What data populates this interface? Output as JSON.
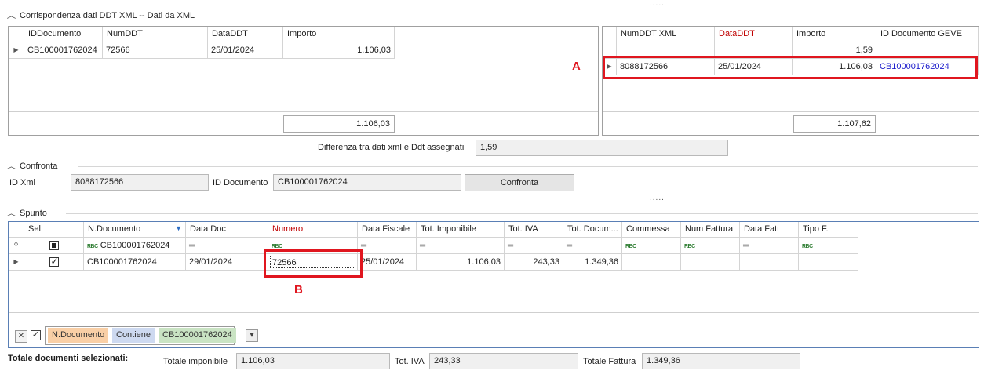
{
  "splitter_grip": ".....",
  "corrispondenza": {
    "title": "Corrispondenza dati DDT  XML --  Dati da XML",
    "ddt_grid": {
      "headers": [
        "IDDocumento",
        "NumDDT",
        "DataDDT",
        "Importo"
      ],
      "rows": [
        [
          "CB100001762024",
          "72566",
          "25/01/2024",
          "1.106,03"
        ]
      ],
      "total": "1.106,03"
    },
    "xml_grid": {
      "headers": [
        "NumDDT XML",
        "DataDDT",
        "Importo",
        "ID Documento GEVE"
      ],
      "filter_row_importo": "1,59",
      "rows": [
        [
          "8088172566",
          "25/01/2024",
          "1.106,03",
          "CB100001762024"
        ]
      ],
      "total": "1.107,62"
    },
    "differenza_label": "Differenza tra dati xml e Ddt assegnati",
    "differenza_value": "1,59",
    "marker": "A"
  },
  "confronta": {
    "title": "Confronta",
    "id_xml_label": "ID Xml",
    "id_xml_value": "8088172566",
    "id_documento_label": "ID Documento",
    "id_documento_value": "CB100001762024",
    "button_label": "Confronta"
  },
  "spunto": {
    "title": "Spunto",
    "headers": [
      "Sel",
      "N.Documento",
      "Data Doc",
      "Numero",
      "Data Fiscale",
      "Tot. Imponibile",
      "Tot. IVA",
      "Tot. Docum...",
      "Commessa",
      "Num Fattura",
      "Data Fatt",
      "Tipo F."
    ],
    "filter_row": {
      "ndocumento": "CB100001762024"
    },
    "rows": [
      {
        "ndocumento": "CB100001762024",
        "data_doc": "29/01/2024",
        "numero": "72566",
        "data_fiscale": "25/01/2024",
        "tot_imponibile": "1.106,03",
        "tot_iva": "243,33",
        "tot_documento": "1.349,36",
        "selected": true
      }
    ],
    "marker": "B",
    "filter_chips": {
      "field": "N.Documento",
      "operator": "Contiene",
      "value": "CB100001762024"
    }
  },
  "totals": {
    "heading": "Totale documenti selezionati:",
    "imponibile_label": "Totale imponibile",
    "imponibile_value": "1.106,03",
    "iva_label": "Tot. IVA",
    "iva_value": "243,33",
    "fattura_label": "Totale Fattura",
    "fattura_value": "1.349,36"
  },
  "colors": {
    "highlight_red": "#e0161f",
    "header_red": "#c00000",
    "link_blue": "#1b1bcc",
    "chip_field": "#f9cfa6",
    "chip_operator": "#cdd9f0",
    "chip_value": "#c9e3c3"
  }
}
